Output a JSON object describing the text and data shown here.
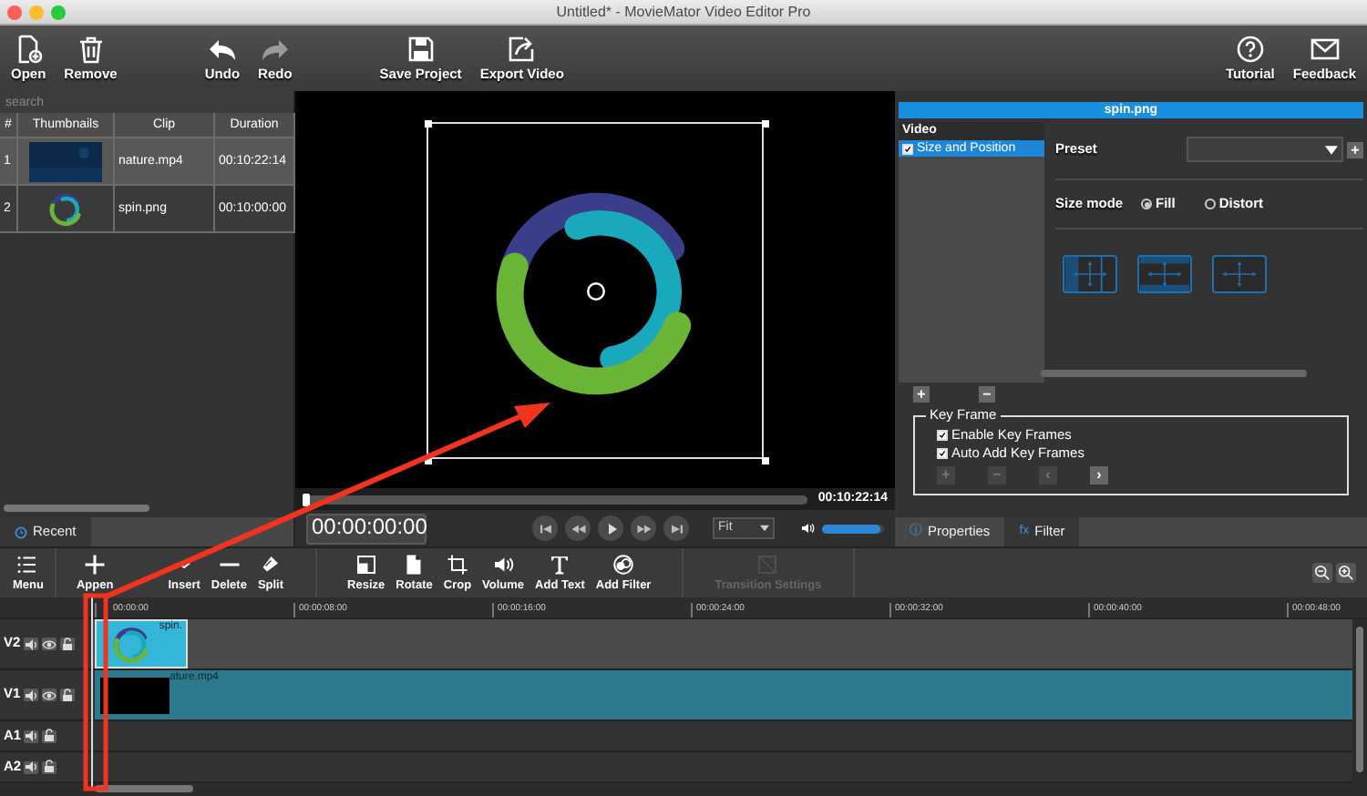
{
  "window": {
    "title": "Untitled* - MovieMator Video Editor Pro"
  },
  "toolbar": {
    "groups": [
      [
        {
          "label": "Open",
          "disabled": false
        },
        {
          "label": "Remove",
          "disabled": false
        }
      ],
      [
        {
          "label": "Undo",
          "disabled": false
        },
        {
          "label": "Redo",
          "disabled": true
        }
      ],
      [
        {
          "label": "Save Project",
          "disabled": false
        },
        {
          "label": "Export Video",
          "disabled": false
        }
      ]
    ],
    "right": [
      {
        "label": "Tutorial",
        "disabled": false
      },
      {
        "label": "Feedback",
        "disabled": false
      }
    ]
  },
  "media": {
    "search_placeholder": "search",
    "columns": [
      "#",
      "Thumbnails",
      "Clip",
      "Duration"
    ],
    "rows": [
      {
        "number": "1",
        "kind": "video",
        "clip": "nature.mp4",
        "duration": "00:10:22:14"
      },
      {
        "number": "2",
        "clip": "spin.png",
        "duration": "00:10:00:00"
      }
    ],
    "tabs": [
      {
        "label": "Recent",
        "selected": true
      }
    ]
  },
  "preview": {
    "duration": "00:10:22:14",
    "timecode": "00:00:00:00",
    "zoom": "Fit",
    "position": {
      "level": 0
    },
    "volume": {
      "level": 0.95
    }
  },
  "properties": {
    "title": "spin.png",
    "group": "Video",
    "filters": [
      {
        "label": "Size and Position",
        "checked": true,
        "selected": true
      }
    ],
    "preset_label": "Preset",
    "preset_button": "+",
    "size_mode_label": "Size mode",
    "size_modes": [
      {
        "label": "Fill",
        "selected": true
      },
      {
        "label": "Distort",
        "selected": false
      }
    ],
    "list_buttons": [
      {
        "label": "+"
      },
      {
        "label": "−"
      }
    ],
    "keyframe": {
      "legend": "Key Frame",
      "options": [
        {
          "label": "Enable Key Frames",
          "checked": true
        },
        {
          "label": "Auto Add Key Frames",
          "checked": true
        }
      ],
      "buttons": [
        {
          "label": "+",
          "disabled": true
        },
        {
          "label": "−",
          "disabled": true
        },
        {
          "label": "‹",
          "disabled": true
        },
        {
          "label": "›",
          "disabled": false
        }
      ]
    },
    "tabs": [
      {
        "label": "Properties",
        "prefix": "ⓘ",
        "selected": false
      },
      {
        "label": "Filter",
        "prefix": "fx",
        "selected": true
      }
    ]
  },
  "timeline": {
    "groups": [
      [
        {
          "label": "Menu",
          "disabled": false
        }
      ],
      [
        {
          "label": "Appen",
          "disabled": false
        },
        {
          "label": "Insert",
          "disabled": false
        },
        {
          "label": "Delete",
          "disabled": false
        },
        {
          "label": "Split",
          "disabled": false
        }
      ],
      [
        {
          "label": "Resize",
          "disabled": false
        },
        {
          "label": "Rotate",
          "disabled": false
        },
        {
          "label": "Crop",
          "disabled": false
        },
        {
          "label": "Volume",
          "disabled": false
        },
        {
          "label": "Add Text",
          "disabled": false
        },
        {
          "label": "Add Filter",
          "disabled": false
        }
      ],
      [
        {
          "label": "Transition Settings",
          "disabled": true
        }
      ]
    ],
    "ruler": [
      "00:00:00",
      "00:00:08:00",
      "00:00:16:00",
      "00:00:24:00",
      "00:00:32:00",
      "00:00:40:00",
      "00:00:48:00"
    ],
    "tracks": [
      {
        "label": "V2",
        "kind": "video",
        "clip": {
          "label": "spin."
        }
      },
      {
        "label": "V1",
        "kind": "video",
        "clip": {
          "label": "ature.mp4",
          "kind": "video"
        }
      },
      {
        "label": "A1",
        "kind": "audio"
      },
      {
        "label": "A2",
        "kind": "audio"
      }
    ]
  },
  "annotations": [
    {
      "kind": "rectangle"
    },
    {
      "kind": "arrow"
    }
  ]
}
